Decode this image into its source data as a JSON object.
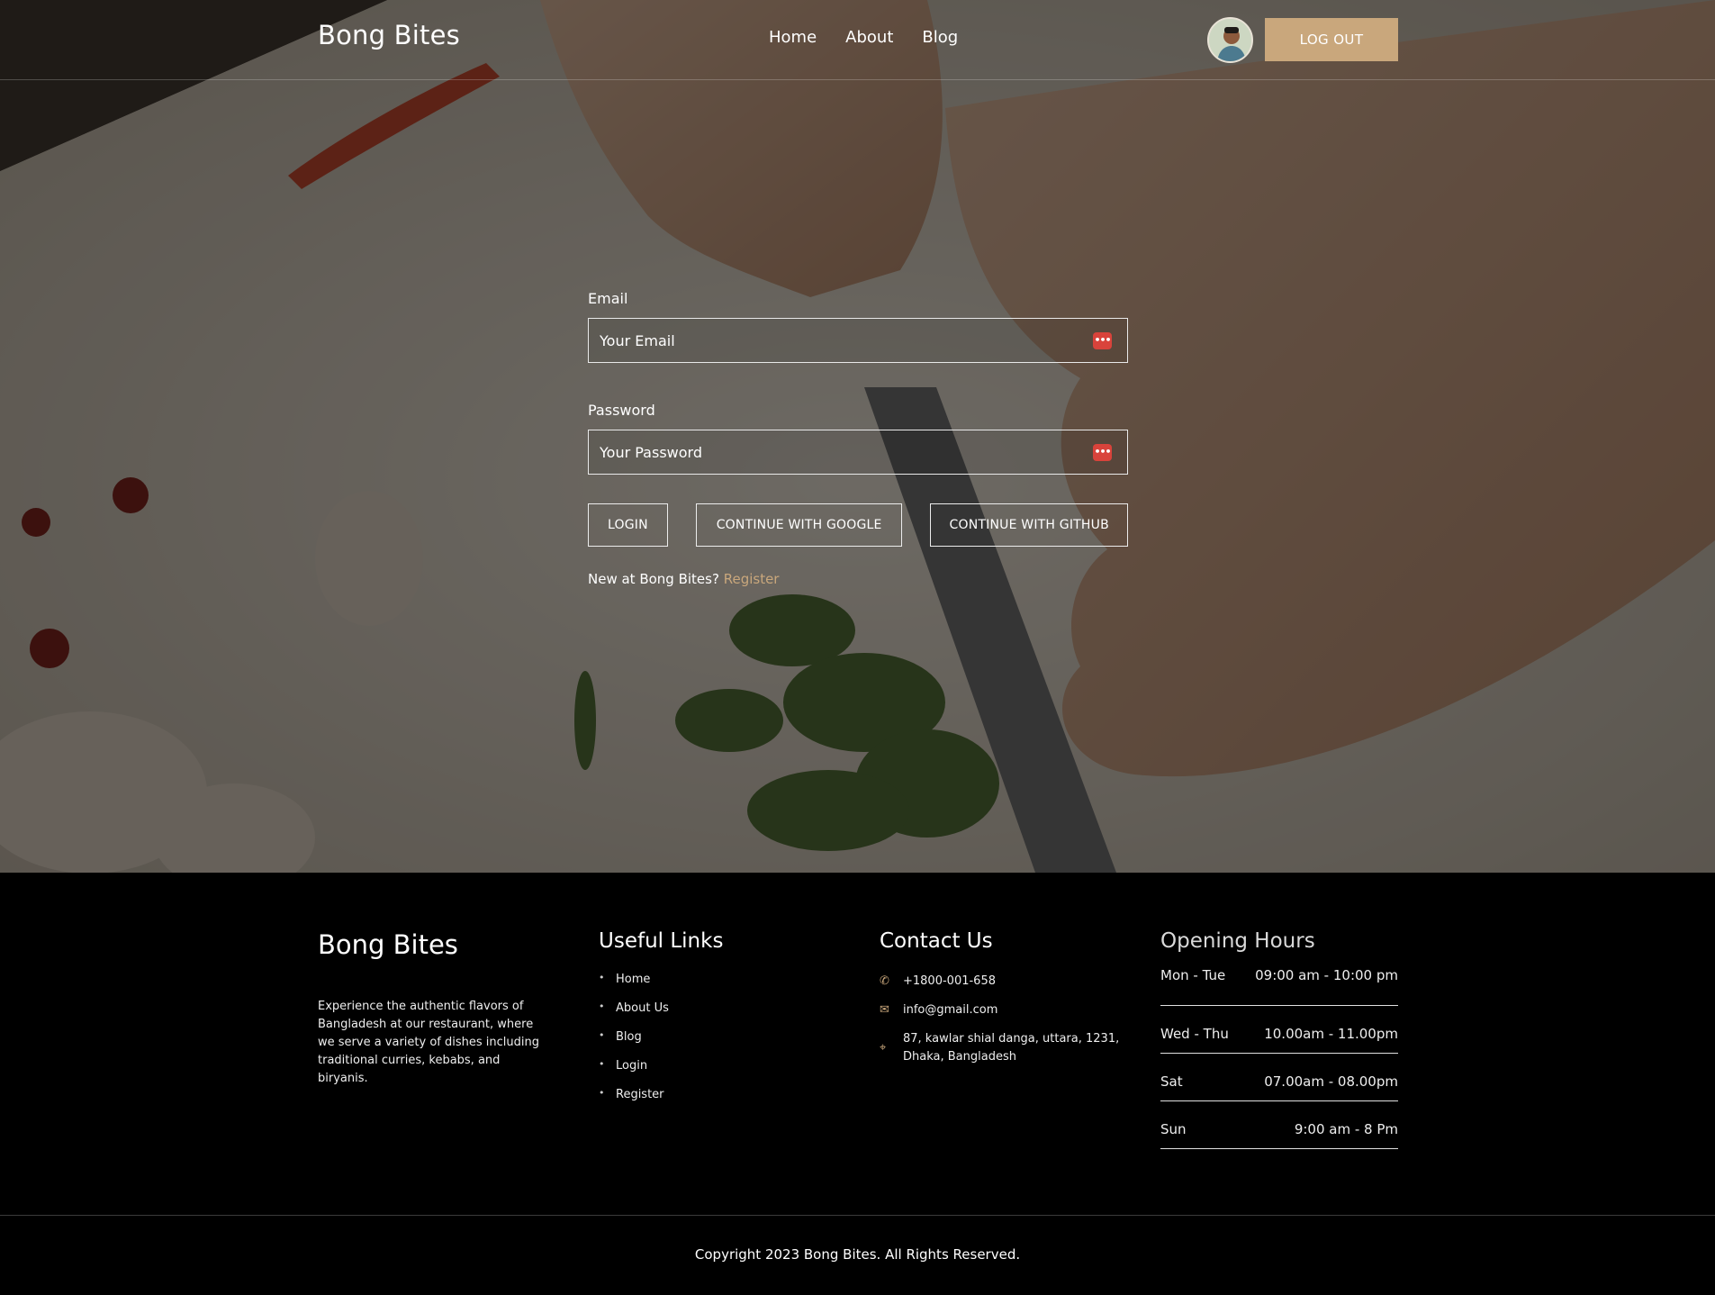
{
  "header": {
    "brand": "Bong Bites",
    "nav": [
      "Home",
      "About",
      "Blog"
    ],
    "logout_label": "LOG OUT"
  },
  "login_form": {
    "email_label": "Email",
    "email_placeholder": "Your Email",
    "password_label": "Password",
    "password_placeholder": "Your Password",
    "login_button": "LOGIN",
    "google_button": "CONTINUE WITH GOOGLE",
    "github_button": "CONTINUE WITH GITHUB",
    "new_text": "New at Bong Bites?",
    "register_link": "Register"
  },
  "footer": {
    "brand": "Bong Bites",
    "description": "Experience the authentic flavors of Bangladesh at our restaurant, where we serve a variety of dishes including traditional curries, kebabs, and biryanis.",
    "useful_links_title": "Useful Links",
    "useful_links": [
      "Home",
      "About Us",
      "Blog",
      "Login",
      "Register"
    ],
    "contact_title": "Contact Us",
    "phone": "+1800-001-658",
    "email": "info@gmail.com",
    "address": "87, kawlar shial danga, uttara, 1231, Dhaka, Bangladesh",
    "hours_title": "Opening Hours",
    "hours": [
      {
        "days": "Mon - Tue",
        "time": "09:00 am - 10:00 pm"
      },
      {
        "days": "Wed - Thu",
        "time": "10.00am - 11.00pm"
      },
      {
        "days": "Sat",
        "time": "07.00am - 08.00pm"
      },
      {
        "days": "Sun",
        "time": "9:00 am - 8 Pm"
      }
    ],
    "copyright": "Copyright 2023 Bong Bites. All Rights Reserved."
  },
  "colors": {
    "accent": "#c9a77c",
    "background": "#000000",
    "text": "#ffffff",
    "icon_badge": "#d9433b"
  },
  "icons": [
    "user-avatar",
    "password-manager-icon",
    "phone-icon",
    "envelope-icon",
    "location-icon"
  ]
}
